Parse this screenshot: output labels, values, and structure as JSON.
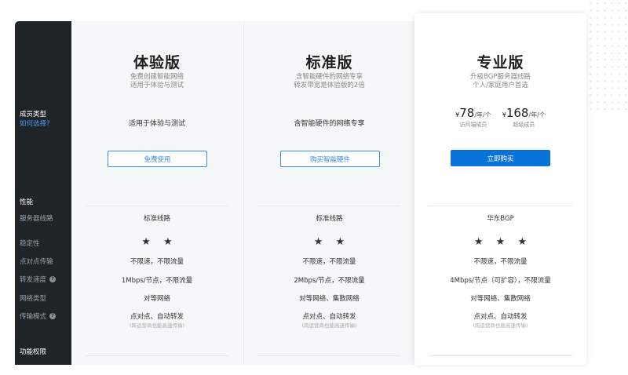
{
  "sidebar": {
    "member_type": "成员类型",
    "how_to_choose": "如何选择?",
    "performance": "性能",
    "server_line": "服务器线路",
    "stability": "稳定性",
    "p2p": "点对点传输",
    "forward_speed": "转发速度",
    "network_type": "网络类型",
    "transfer_mode": "传输模式",
    "features": "功能权限"
  },
  "plans": [
    {
      "name": "体验版",
      "sub1": "免费创建智能网络",
      "sub2": "适用于体验与测试",
      "feature": "适用于体验与测试",
      "button": "免费使用",
      "server_line": "标准线路",
      "stability": "★ ★",
      "p2p": "不限速，不限流量",
      "forward_speed": "1Mbps/节点，不限流量",
      "network_type": "对等网络",
      "transfer_mode": "点对点、自动转发",
      "transfer_note": "(跨运营商也能高速传输)"
    },
    {
      "name": "标准版",
      "sub1": "含智能硬件的网络专享",
      "sub2": "转发带宽是体验版的2倍",
      "feature": "含智能硬件的网络专享",
      "button": "购买智能硬件",
      "server_line": "标准线路",
      "stability": "★ ★",
      "p2p": "不限速，不限流量",
      "forward_speed": "2Mbps/节点，不限流量",
      "network_type": "对等网络、集散网络",
      "transfer_mode": "点对点、自动转发",
      "transfer_note": "(跨运营商也能高速传输)"
    },
    {
      "name": "专业版",
      "sub1": "升级BGP服务器线路",
      "sub2": "个人/家庭用户首选",
      "price1": {
        "currency": "¥",
        "amount": "78",
        "unit": "/年/个",
        "label": "访问端成员"
      },
      "price2": {
        "currency": "¥",
        "amount": "168",
        "unit": "/年/个",
        "label": "超级成员"
      },
      "button": "立即购买",
      "server_line": "华东BGP",
      "stability": "★ ★ ★",
      "p2p": "不限速，不限流量",
      "forward_speed": "4Mbps/节点（可扩容），不限流量",
      "network_type": "对等网络、集散网络",
      "transfer_mode": "点对点、自动转发",
      "transfer_note": "(跨运营商也能高速传输)"
    }
  ],
  "colors": {
    "sidebar_bg": "#1f2428",
    "accent": "#0a73d9",
    "link": "#4a9bf0"
  }
}
